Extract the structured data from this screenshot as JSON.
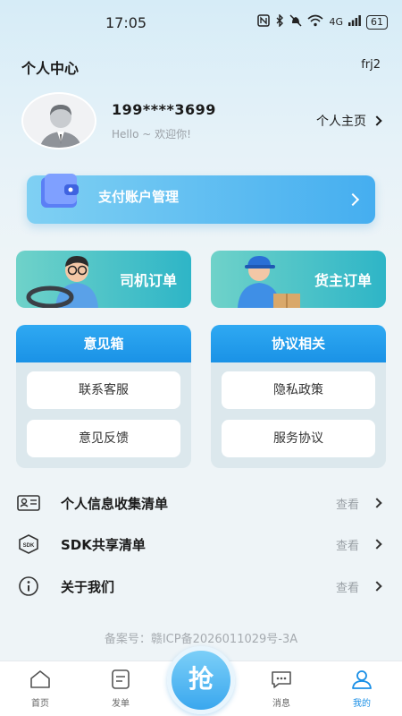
{
  "status_bar": {
    "time": "17:05",
    "network": "4G",
    "battery": "61"
  },
  "header": {
    "title": "个人中心",
    "right_text": "frj2"
  },
  "profile": {
    "phone": "199****3699",
    "greeting": "Hello ~ 欢迎你!",
    "home_link": "个人主页"
  },
  "payment_card": {
    "label": "支付账户管理"
  },
  "orders": {
    "driver": "司机订单",
    "shipper": "货主订单"
  },
  "feedback_panel": {
    "title": "意见箱",
    "buttons": [
      "联系客服",
      "意见反馈"
    ]
  },
  "agreement_panel": {
    "title": "协议相关",
    "buttons": [
      "隐私政策",
      "服务协议"
    ]
  },
  "list": [
    {
      "label": "个人信息收集清单",
      "action": "查看",
      "icon": "id-card-icon"
    },
    {
      "label": "SDK共享清单",
      "action": "查看",
      "icon": "sdk-box-icon"
    },
    {
      "label": "关于我们",
      "action": "查看",
      "icon": "info-icon"
    }
  ],
  "icp": "备案号：赣ICP备2026011029号-3A",
  "tabbar": {
    "tabs": [
      "首页",
      "发单",
      "消息",
      "我的"
    ],
    "center": "抢",
    "active": "我的"
  },
  "colors": {
    "accent": "#1a8fe6",
    "teal": "#2eb5c7"
  }
}
